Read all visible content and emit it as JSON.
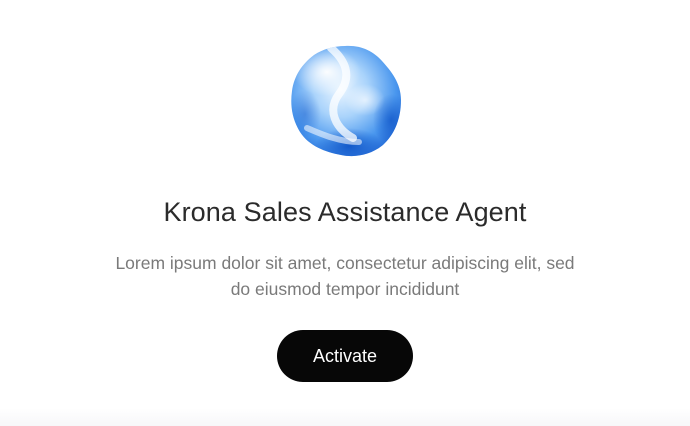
{
  "agent": {
    "title": "Krona Sales Assistance Agent",
    "description_lines": [
      "Lorem ipsum dolor sit amet, consectetur adipiscing elit, sed",
      "do eiusmod tempor incididunt"
    ],
    "activate_label": "Activate",
    "avatar_icon": "gradient-orb-icon"
  },
  "colors": {
    "title": "#2b2b2b",
    "description": "#7a7a7a",
    "button_bg": "#070707",
    "button_text": "#ffffff",
    "orb_primary": "#2f7fe6",
    "orb_highlight": "#dff0ff"
  }
}
